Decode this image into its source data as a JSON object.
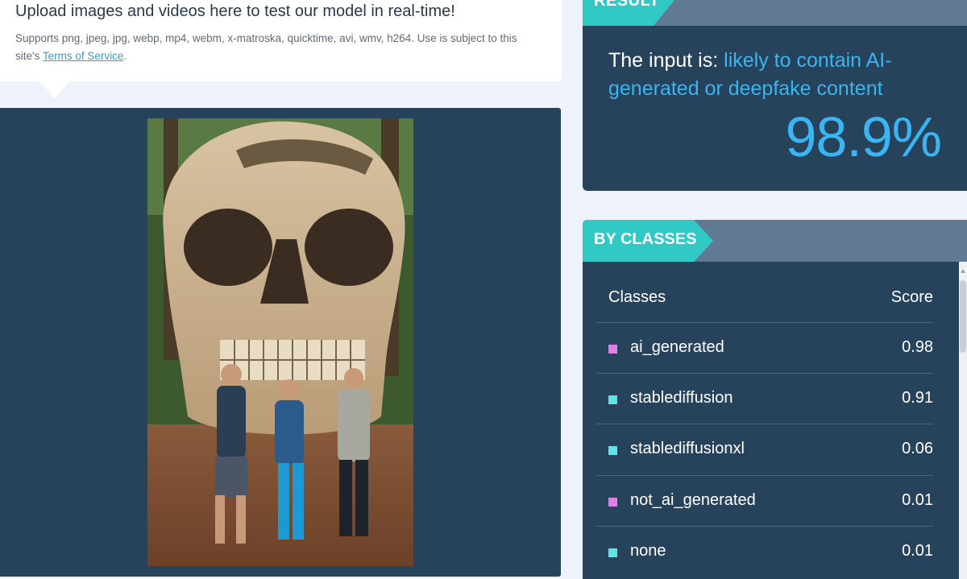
{
  "upload": {
    "title": "Upload images and videos here to test our model in real-time!",
    "description": "Supports png, jpeg, jpg, webp, mp4, webm, x-matroska, quicktime, avi, wmv, h264. Use is subject to this site's ",
    "tos_link": "Terms of Service",
    "tos_suffix": "."
  },
  "result": {
    "tag": "RESULT",
    "prefix": "The input is: ",
    "verdict": "likely to contain AI-generated or deepfake content",
    "percentage": "98.9%"
  },
  "classes": {
    "tag": "BY CLASSES",
    "header_classes": "Classes",
    "header_score": "Score",
    "rows": [
      {
        "label": "ai_generated",
        "score": "0.98",
        "color": "#e07fe6"
      },
      {
        "label": "stablediffusion",
        "score": "0.91",
        "color": "#5ee3e6"
      },
      {
        "label": "stablediffusionxl",
        "score": "0.06",
        "color": "#5ee3e6"
      },
      {
        "label": "not_ai_generated",
        "score": "0.01",
        "color": "#e07fe6"
      },
      {
        "label": "none",
        "score": "0.01",
        "color": "#5ee3e6"
      }
    ]
  },
  "colors": {
    "panel": "#27435c",
    "accent_tag": "#31c8c6",
    "verdict": "#3ab4f2"
  }
}
